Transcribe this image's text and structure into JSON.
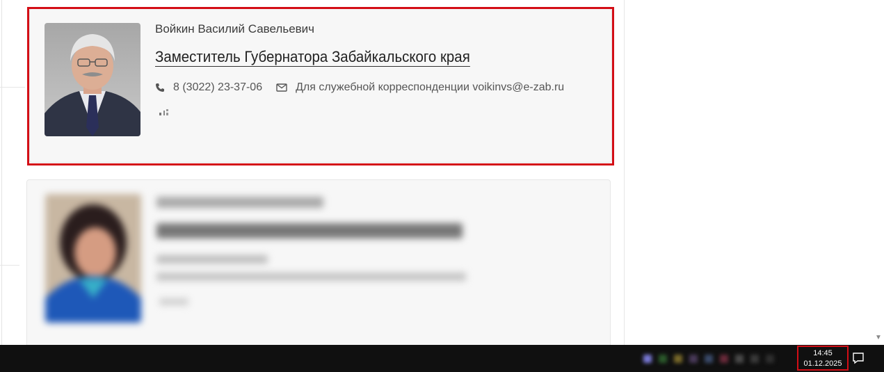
{
  "person": {
    "name": "Войкин Василий Савельевич",
    "position": "Заместитель Губернатора Забайкальского края",
    "phone": "8 (3022) 23-37-06",
    "email_label": "Для служебной корреспонденции voikinvs@e-zab.ru"
  },
  "icons": {
    "phone": "phone-icon",
    "email": "envelope-icon",
    "notifications": "speech-bubble-icon"
  },
  "colors": {
    "highlight": "#d30e16",
    "taskbar": "#101010"
  },
  "taskbar": {
    "time": "14:45",
    "date": "01.12.2025"
  }
}
